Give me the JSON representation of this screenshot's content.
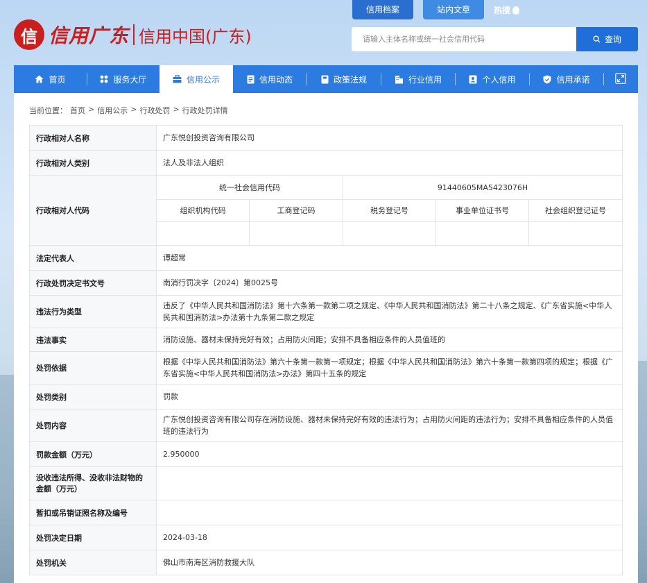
{
  "header": {
    "logo_mark": "信",
    "logo_script": "信用广东",
    "logo_main": "信用中国(广东)",
    "top_tabs": [
      "信用档案",
      "站内文章"
    ],
    "hot_label": "热搜",
    "search_placeholder": "请输入主体名称或统一社会信用代码",
    "search_button": "查询"
  },
  "nav": {
    "items": [
      {
        "label": "首页",
        "icon": "home-icon"
      },
      {
        "label": "服务大厅",
        "icon": "grid-icon"
      },
      {
        "label": "信用公示",
        "icon": "briefcase-icon"
      },
      {
        "label": "信用动态",
        "icon": "document-icon"
      },
      {
        "label": "政策法规",
        "icon": "book-icon"
      },
      {
        "label": "行业信用",
        "icon": "building-icon"
      },
      {
        "label": "个人信用",
        "icon": "id-card-icon"
      },
      {
        "label": "信用承诺",
        "icon": "shield-icon"
      }
    ],
    "active_index": 2,
    "expand_icon": "expand-icon"
  },
  "breadcrumb": {
    "prefix": "当前位置：",
    "items": [
      "首页",
      "信用公示",
      "行政处罚",
      "行政处罚详情"
    ],
    "separator": ">"
  },
  "detail": {
    "name_label": "行政相对人名称",
    "name_value": "广东悦创投资咨询有限公司",
    "type_label": "行政相对人类别",
    "type_value": "法人及非法人组织",
    "code_label": "行政相对人代码",
    "usc_label": "统一社会信用代码",
    "usc_value": "91440605MA5423076H",
    "code_headers": [
      "组织机构代码",
      "工商登记码",
      "税务登记号",
      "事业单位证书号",
      "社会组织登记证号"
    ],
    "code_values": [
      "",
      "",
      "",
      "",
      ""
    ],
    "rep_label": "法定代表人",
    "rep_value": "谭超常",
    "doc_label": "行政处罚决定书文号",
    "doc_value": "南消行罚决字〔2024〕第0025号",
    "violation_type_label": "违法行为类型",
    "violation_type_value": "违反了《中华人民共和国消防法》第十六条第一款第二项之规定、《中华人民共和国消防法》第二十八条之规定、《广东省实施<中华人民共和国消防法>办法第十九条第二款之规定",
    "facts_label": "违法事实",
    "facts_value": "消防设施、器材未保持完好有效；占用防火间距；安排不具备相应条件的人员值班的",
    "basis_label": "处罚依据",
    "basis_value": "根据《中华人民共和国消防法》第六十条第一款第一项规定；根据《中华人民共和国消防法》第六十条第一款第四项的规定；根据《广东省实施<中华人民共和国消防法>办法》第四十五条的规定",
    "category_label": "处罚类别",
    "category_value": "罚款",
    "content_label": "处罚内容",
    "content_value": "广东悦创投资咨询有限公司存在消防设施、器材未保持完好有效的违法行为；占用防火间距的违法行为；安排不具备相应条件的人员值班的违法行为",
    "fine_label": "罚款金额（万元）",
    "fine_value": "2.950000",
    "confiscation_label": "没收违法所得、没收非法财物的金额（万元）",
    "confiscation_value": "",
    "license_label": "暂扣或吊销证照名称及编号",
    "license_value": "",
    "date_label": "处罚决定日期",
    "date_value": "2024-03-18",
    "authority_label": "处罚机关",
    "authority_value": "佛山市南海区消防救援大队"
  }
}
